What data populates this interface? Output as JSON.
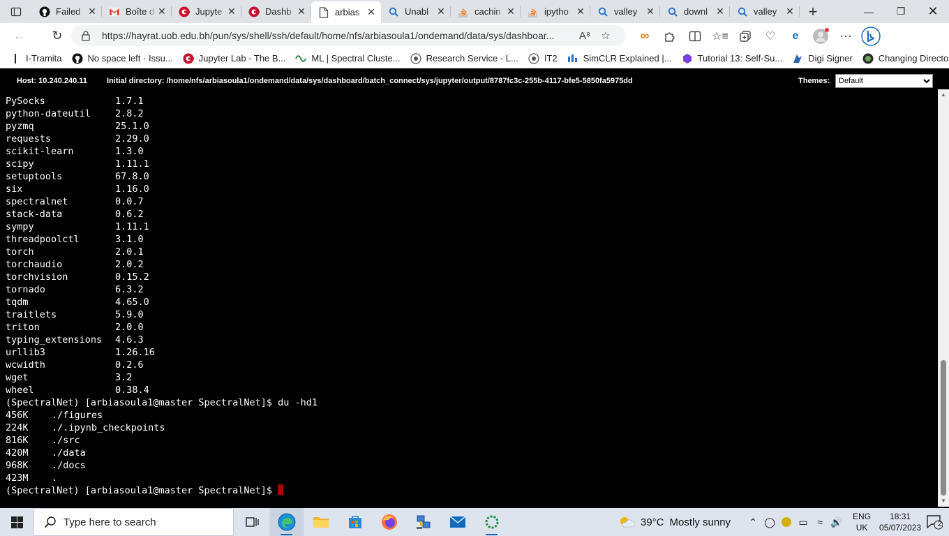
{
  "browser": {
    "tabs": [
      {
        "label": "Failed",
        "icon": "github-icon"
      },
      {
        "label": "Boîte d",
        "icon": "gmail-icon"
      },
      {
        "label": "Jupyte",
        "icon": "ondemand-icon"
      },
      {
        "label": "Dashb",
        "icon": "ondemand-icon"
      },
      {
        "label": "arbias",
        "icon": "page-icon",
        "active": true
      },
      {
        "label": "Unabl",
        "icon": "bing-search-icon"
      },
      {
        "label": "cachin",
        "icon": "stackoverflow-icon"
      },
      {
        "label": "ipytho",
        "icon": "stackoverflow-icon"
      },
      {
        "label": "valley",
        "icon": "bing-search-icon"
      },
      {
        "label": "downl",
        "icon": "bing-search-icon"
      },
      {
        "label": "valley",
        "icon": "bing-search-icon"
      }
    ],
    "url": "https://hayrat.uob.edu.bh/pun/sys/shell/ssh/default/home/nfs/arbiasoula1/ondemand/data/sys/dashboar...",
    "bookmarks": [
      {
        "label": "I-Tramita"
      },
      {
        "label": "No space left · Issu..."
      },
      {
        "label": "Jupyter Lab - The B..."
      },
      {
        "label": "ML | Spectral Cluste..."
      },
      {
        "label": "Research Service - L..."
      },
      {
        "label": "IT2"
      },
      {
        "label": "SimCLR Explained |..."
      },
      {
        "label": "Tutorial 13: Self-Su..."
      },
      {
        "label": "Digi Signer"
      },
      {
        "label": "Changing Directori..."
      }
    ]
  },
  "shell": {
    "host": "Host: 10.240.240.11",
    "directory": "Initial directory: /home/nfs/arbiasoula1/ondemand/data/sys/dashboard/batch_connect/sys/jupyter/output/8787fc3c-255b-4117-bfe5-5850fa5975dd",
    "themes_label": "Themes:",
    "theme_selected": "Default"
  },
  "terminal": {
    "packages": [
      [
        "PySocks",
        "1.7.1"
      ],
      [
        "python-dateutil",
        "2.8.2"
      ],
      [
        "pyzmq",
        "25.1.0"
      ],
      [
        "requests",
        "2.29.0"
      ],
      [
        "scikit-learn",
        "1.3.0"
      ],
      [
        "scipy",
        "1.11.1"
      ],
      [
        "setuptools",
        "67.8.0"
      ],
      [
        "six",
        "1.16.0"
      ],
      [
        "spectralnet",
        "0.0.7"
      ],
      [
        "stack-data",
        "0.6.2"
      ],
      [
        "sympy",
        "1.11.1"
      ],
      [
        "threadpoolctl",
        "3.1.0"
      ],
      [
        "torch",
        "2.0.1"
      ],
      [
        "torchaudio",
        "2.0.2"
      ],
      [
        "torchvision",
        "0.15.2"
      ],
      [
        "tornado",
        "6.3.2"
      ],
      [
        "tqdm",
        "4.65.0"
      ],
      [
        "traitlets",
        "5.9.0"
      ],
      [
        "triton",
        "2.0.0"
      ],
      [
        "typing_extensions",
        "4.6.3"
      ],
      [
        "urllib3",
        "1.26.16"
      ],
      [
        "wcwidth",
        "0.2.6"
      ],
      [
        "wget",
        "3.2"
      ],
      [
        "wheel",
        "0.38.4"
      ]
    ],
    "command_line": "(SpectralNet) [arbiasoula1@master SpectralNet]$ du -hd1",
    "du_output": [
      [
        "456K",
        "./figures"
      ],
      [
        "224K",
        "./.ipynb_checkpoints"
      ],
      [
        "816K",
        "./src"
      ],
      [
        "420M",
        "./data"
      ],
      [
        "968K",
        "./docs"
      ],
      [
        "423M",
        "."
      ]
    ],
    "prompt": "(SpectralNet) [arbiasoula1@master SpectralNet]$"
  },
  "taskbar": {
    "search_placeholder": "Type here to search",
    "weather_temp": "39°C",
    "weather_text": "Mostly sunny",
    "lang_line1": "ENG",
    "lang_line2": "UK",
    "time": "18:31",
    "date": "05/07/2023",
    "notification_count": "2"
  },
  "colors": {
    "terminal_bg": "#000000",
    "terminal_fg": "#ffffff",
    "cursor": "#aa0000",
    "ondemand_red": "#c8102e",
    "taskbar_bg": "#dde4ee"
  }
}
